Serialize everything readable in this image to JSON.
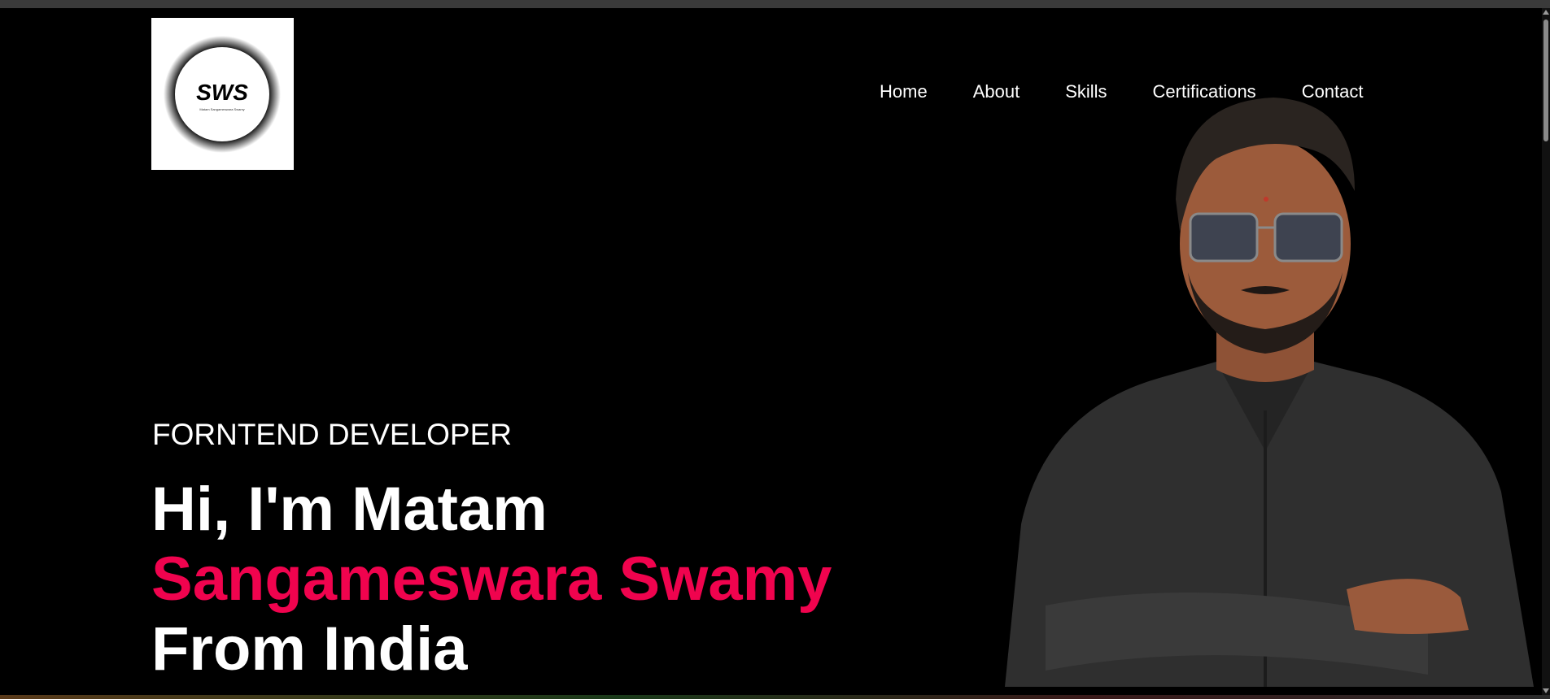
{
  "header": {
    "logo": {
      "monogram": "SWS",
      "caption": "Matam Sangameswara Swamy"
    },
    "nav": [
      {
        "label": "Home"
      },
      {
        "label": "About"
      },
      {
        "label": "Skills"
      },
      {
        "label": "Certifications"
      },
      {
        "label": "Contact"
      }
    ]
  },
  "hero": {
    "subtitle": "FORNTEND DEVELOPER",
    "greeting": "Hi, I'm Matam",
    "name": "Sangameswara Swamy",
    "location": "From India",
    "accent_color": "#f0034e"
  },
  "icons": [
    "logo-icon",
    "portrait-image"
  ]
}
